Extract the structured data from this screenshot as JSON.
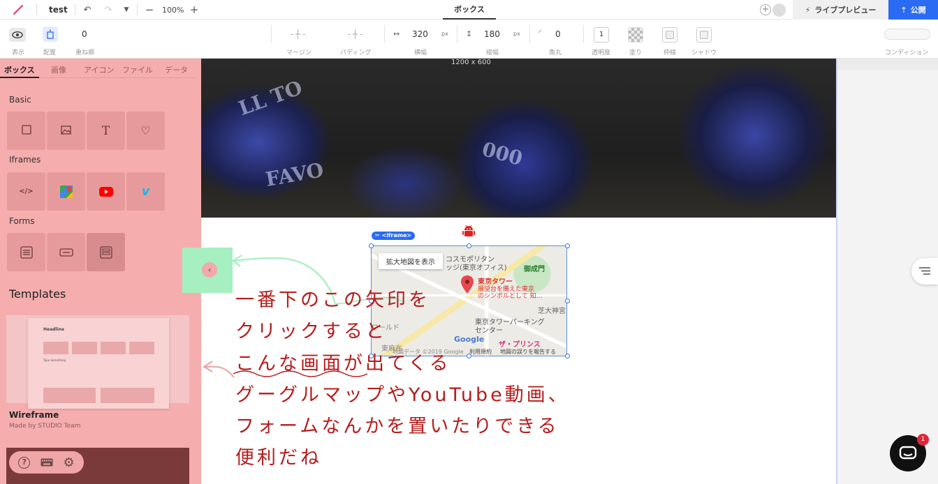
{
  "topbar": {
    "project_name": "test",
    "zoom": "100%",
    "center_tab": "ボックス",
    "live_preview": "ライブプレビュー",
    "publish": "公開"
  },
  "toolbar": {
    "display_label": "表示",
    "placement_label": "配置",
    "zindex_value": "0",
    "zindex_label": "重ね順",
    "margin_label": "マージン",
    "padding_label": "パディング",
    "width_value": "320",
    "width_unit": "px",
    "width_label": "横幅",
    "height_value": "180",
    "height_unit": "px",
    "height_label": "縦幅",
    "radius_value": "0",
    "radius_label": "角丸",
    "opacity_value": "1",
    "opacity_label": "透明度",
    "fill_label": "塗り",
    "border_label": "枠線",
    "shadow_label": "シャドウ",
    "condition_label": "コンディション"
  },
  "left_panel": {
    "tabs": [
      "ボックス",
      "画像",
      "アイコン",
      "ファイル",
      "データ"
    ],
    "sections": {
      "basic": "Basic",
      "iframes": "Iframes",
      "forms": "Forms"
    },
    "templates_title": "Templates",
    "template_name": "Wireframe",
    "template_author": "Made by STUDIO Team",
    "template_preview": {
      "headline": "Headline",
      "type_label": "Type Something"
    }
  },
  "canvas": {
    "hero_size": "1200 x 600",
    "iframe_tag": "<iframe>",
    "map": {
      "enlarge_button": "拡大地図を表示",
      "labels": {
        "cosmo": "コスモポリタン",
        "cosmo2": "ッジ(東京オフィス)",
        "onarimon": "御成門",
        "tower": "東京タワー",
        "tower_desc": "展望台を備えた東京",
        "tower_desc2": "のシンボルとして 知…",
        "shiba": "芝大神宮",
        "parking": "東京タワーパーキング",
        "parking2": "センター",
        "prince": "ザ・プリンス",
        "world": "ワールド",
        "azabu": "東麻布",
        "google": "Google"
      },
      "footer_left": "地図データ ©2019 Google",
      "footer_terms": "利用規約",
      "footer_report": "地図の誤りを報告する"
    }
  },
  "annotation": {
    "lines": [
      "一番下のこの矢印を",
      "クリックすると",
      "こんな画面が出てくる",
      "グーグルマップやYouTube動画、",
      "フォームなんかを置いたりできる",
      "便利だね"
    ]
  },
  "chat": {
    "badge_count": "1"
  },
  "colors": {
    "accent_blue": "#2b6bf3",
    "panel_highlight": "#f5adae",
    "arrow_highlight": "#a6efc1",
    "annotation_red": "#b51d1d"
  }
}
